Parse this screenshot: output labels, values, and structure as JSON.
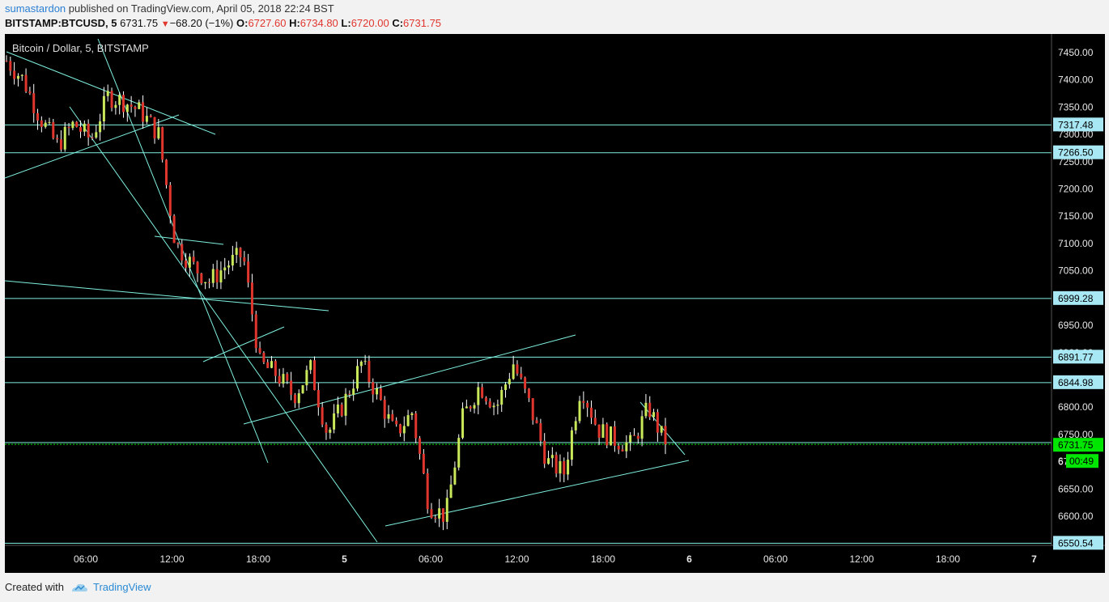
{
  "header": {
    "user": "sumastardon",
    "published_text": " published on TradingView.com, April 05, 2018 22:24 BST",
    "symbol": "BITSTAMP:BTCUSD, 5",
    "last": "6731.75",
    "change": "−68.20 (−1%)",
    "o_label": "O:",
    "o_value": "6727.60",
    "h_label": "H:",
    "h_value": "6734.80",
    "l_label": "L:",
    "l_value": "6720.00",
    "c_label": "C:",
    "c_value": "6731.75"
  },
  "footer": {
    "created_with": "Created with",
    "brand": "TradingView"
  },
  "colors": {
    "up": "#c9e85a",
    "down": "#e0362d",
    "wick": "#ffffff",
    "line": "#7ff0e0",
    "price_tag": "#a8e8f4",
    "last_tag": "#00e600",
    "bg": "#000000"
  },
  "chart_data": {
    "type": "candlestick",
    "title": "Bitcoin / Dollar, 5, BITSTAMP",
    "ylim": [
      6530,
      7480
    ],
    "y_ticks": [
      "7450.00",
      "7400.00",
      "7350.00",
      "7300.00",
      "7250.00",
      "7200.00",
      "7150.00",
      "7100.00",
      "7050.00",
      "7000.00",
      "6950.00",
      "6900.00",
      "6850.00",
      "6800.00",
      "6750.00",
      "6700.00",
      "6650.00",
      "6600.00"
    ],
    "x_ticks": [
      "06:00",
      "12:00",
      "18:00",
      "5",
      "06:00",
      "12:00",
      "18:00",
      "6",
      "06:00",
      "12:00",
      "18:00",
      "7"
    ],
    "horizontal_levels": [
      7317.48,
      7266.5,
      6999.28,
      6891.77,
      6844.98,
      6735.0,
      6550.54
    ],
    "level_labels": [
      "7317.48",
      "7266.50",
      "6999.28",
      "6891.77",
      "6844.98",
      "6550.54"
    ],
    "last_price_label": "6731.75",
    "countdown": "00:49",
    "countdown_price_partial": "6",
    "price_path": [
      [
        0,
        7435
      ],
      [
        1,
        7400
      ],
      [
        2,
        7330
      ],
      [
        3,
        7280
      ],
      [
        4,
        7320
      ],
      [
        5,
        7290
      ],
      [
        6,
        7370
      ],
      [
        7,
        7360
      ],
      [
        8,
        7340
      ],
      [
        9,
        7300
      ],
      [
        10,
        7100
      ],
      [
        11,
        7060
      ],
      [
        12,
        7030
      ],
      [
        13,
        7060
      ],
      [
        14,
        7080
      ],
      [
        15,
        6880
      ],
      [
        16,
        6860
      ],
      [
        17,
        6820
      ],
      [
        18,
        6870
      ],
      [
        19,
        6750
      ],
      [
        20,
        6810
      ],
      [
        21,
        6880
      ],
      [
        22,
        6820
      ],
      [
        23,
        6750
      ],
      [
        24,
        6790
      ],
      [
        25,
        6620
      ],
      [
        26,
        6600
      ],
      [
        27,
        6780
      ],
      [
        28,
        6840
      ],
      [
        29,
        6800
      ],
      [
        30,
        6880
      ],
      [
        31,
        6800
      ],
      [
        32,
        6700
      ],
      [
        33,
        6680
      ],
      [
        34,
        6840
      ],
      [
        35,
        6760
      ],
      [
        36,
        6740
      ],
      [
        37,
        6730
      ],
      [
        38,
        6800
      ],
      [
        39,
        6731.75
      ]
    ]
  }
}
